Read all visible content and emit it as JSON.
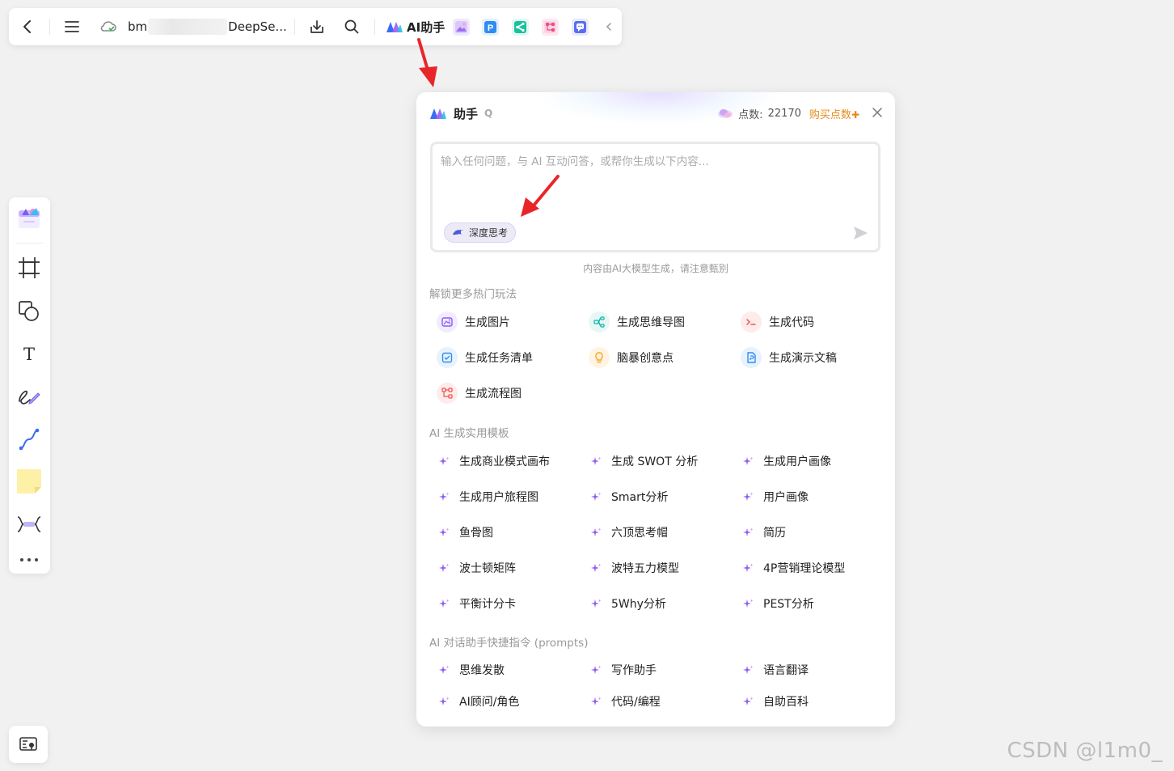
{
  "toolbar": {
    "doc_name_prefix": "bm",
    "doc_name_suffix": "DeepSe...",
    "ai_label": "AI助手",
    "icons": [
      "back-icon",
      "menu-icon",
      "cloud-sync-icon",
      "download-icon",
      "search-icon",
      "ai-logo-icon",
      "image-plugin-icon",
      "p-plugin-icon",
      "share-plugin-icon",
      "flow-plugin-icon",
      "chat-plugin-icon",
      "collapse-chevron-icon"
    ]
  },
  "rail": {
    "tools": [
      "template-icon",
      "frame-icon",
      "shape-icon",
      "text-icon",
      "pen-icon",
      "connector-icon",
      "sticky-note-icon",
      "mindmap-icon",
      "more-icon"
    ],
    "text_tool_glyph": "T"
  },
  "panel": {
    "title": "助手",
    "title_hint": "Q",
    "points_label": "点数:",
    "points_value": "22170",
    "buy_label": "购买点数",
    "buy_plus": "✚",
    "input_placeholder": "输入任何问题，与 AI 互动问答，或帮你生成以下内容...",
    "deep_think_label": "深度思考",
    "disclaimer": "内容由AI大模型生成，请注意甄别",
    "section_hot": "解锁更多热门玩法",
    "hot_items": [
      {
        "label": "生成图片",
        "icon": "image-gen-icon",
        "color": "#8a5cf6",
        "bg": "#f1ecfe"
      },
      {
        "label": "生成思维导图",
        "icon": "mindmap-gen-icon",
        "color": "#13b5a6",
        "bg": "#e6f8f6"
      },
      {
        "label": "生成代码",
        "icon": "code-gen-icon",
        "color": "#f0534e",
        "bg": "#fdeceb"
      },
      {
        "label": "生成任务清单",
        "icon": "task-gen-icon",
        "color": "#2f8cf0",
        "bg": "#e8f2fd"
      },
      {
        "label": "脑暴创意点",
        "icon": "idea-bulb-icon",
        "color": "#f5a623",
        "bg": "#fff4e3"
      },
      {
        "label": "生成演示文稿",
        "icon": "slides-gen-icon",
        "color": "#2f8cf0",
        "bg": "#e8f2fd"
      },
      {
        "label": "生成流程图",
        "icon": "flowchart-gen-icon",
        "color": "#f0534e",
        "bg": "#fdeceb"
      }
    ],
    "section_templates": "AI 生成实用模板",
    "templates": [
      "生成商业模式画布",
      "生成 SWOT 分析",
      "生成用户画像",
      "生成用户旅程图",
      "Smart分析",
      "用户画像",
      "鱼骨图",
      "六顶思考帽",
      "简历",
      "波士顿矩阵",
      "波特五力模型",
      "4P营销理论模型",
      "平衡计分卡",
      "5Why分析",
      "PEST分析"
    ],
    "section_prompts": "AI 对话助手快捷指令 (prompts)",
    "prompts": [
      "思维发散",
      "写作助手",
      "语言翻译",
      "AI顾问/角色",
      "代码/编程",
      "自助百科"
    ]
  },
  "watermark": "CSDN @l1m0_",
  "colors": {
    "accent_purple": "#8a5cf6",
    "buy_orange": "#e88a1a",
    "arrow_red": "#e8262a"
  }
}
